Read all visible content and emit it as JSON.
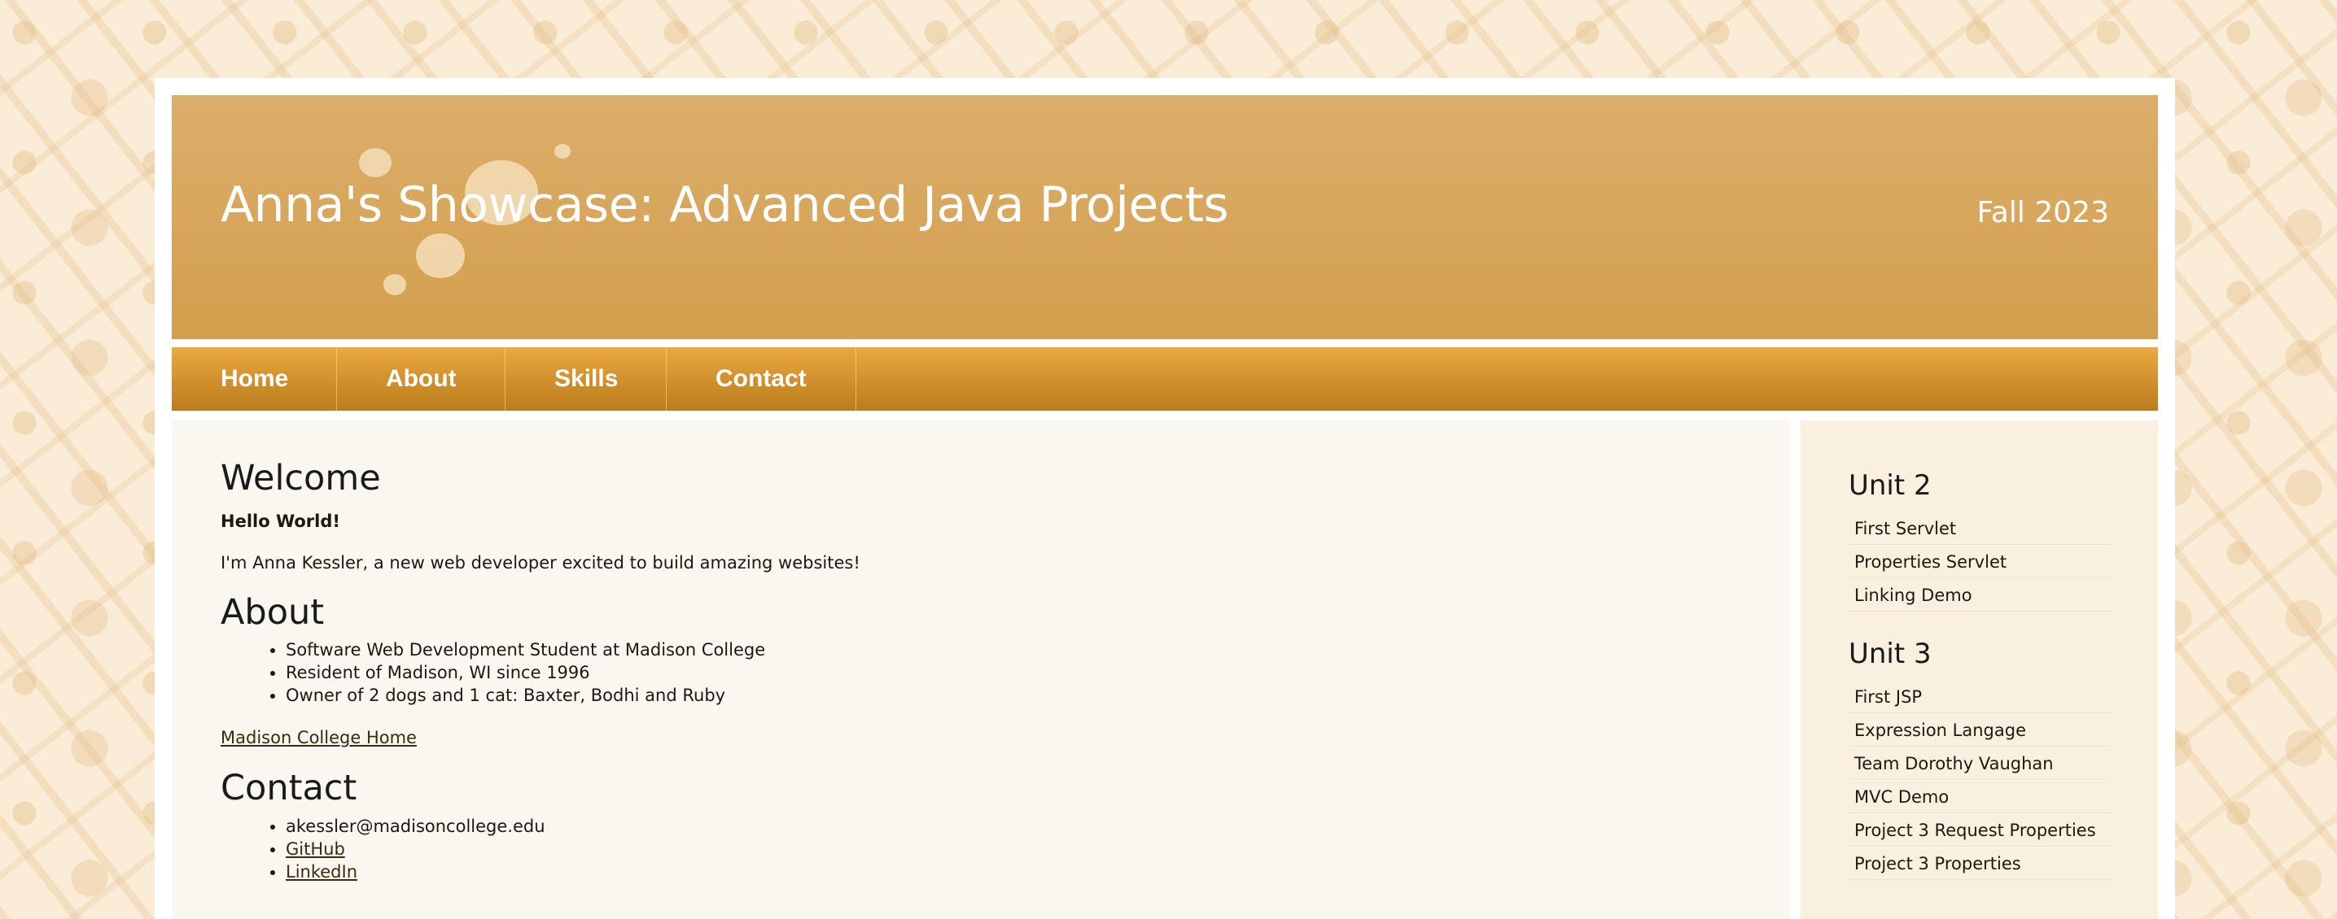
{
  "header": {
    "title": "Anna's Showcase: Advanced Java Projects",
    "term": "Fall 2023"
  },
  "nav": {
    "items": [
      {
        "label": "Home"
      },
      {
        "label": "About"
      },
      {
        "label": "Skills"
      },
      {
        "label": "Contact"
      }
    ]
  },
  "main": {
    "welcome": {
      "heading": "Welcome",
      "greeting": "Hello World!",
      "intro": "I'm Anna Kessler, a new web developer excited to build amazing websites!"
    },
    "about": {
      "heading": "About",
      "items": [
        "Software Web Development Student at Madison College",
        "Resident of Madison, WI since 1996",
        "Owner of 2 dogs and 1 cat: Baxter, Bodhi and Ruby"
      ],
      "link": "Madison College Home"
    },
    "contact": {
      "heading": "Contact",
      "email": "akessler@madisoncollege.edu",
      "github": "GitHub",
      "linkedin": "LinkedIn"
    }
  },
  "sidebar": {
    "sections": [
      {
        "heading": "Unit 2",
        "links": [
          "First Servlet",
          "Properties Servlet",
          "Linking Demo"
        ]
      },
      {
        "heading": "Unit 3",
        "links": [
          "First JSP",
          "Expression Langage",
          "Team Dorothy Vaughan",
          "MVC Demo",
          "Project 3 Request Properties",
          "Project 3 Properties"
        ]
      }
    ]
  },
  "colors": {
    "header_top": "#dcae6c",
    "header_bottom": "#d39f4d",
    "nav_top": "#eba940",
    "nav_bottom": "#bd7c1c",
    "content_bg": "#faf7f0",
    "sidebar_bg": "#faf0df"
  }
}
